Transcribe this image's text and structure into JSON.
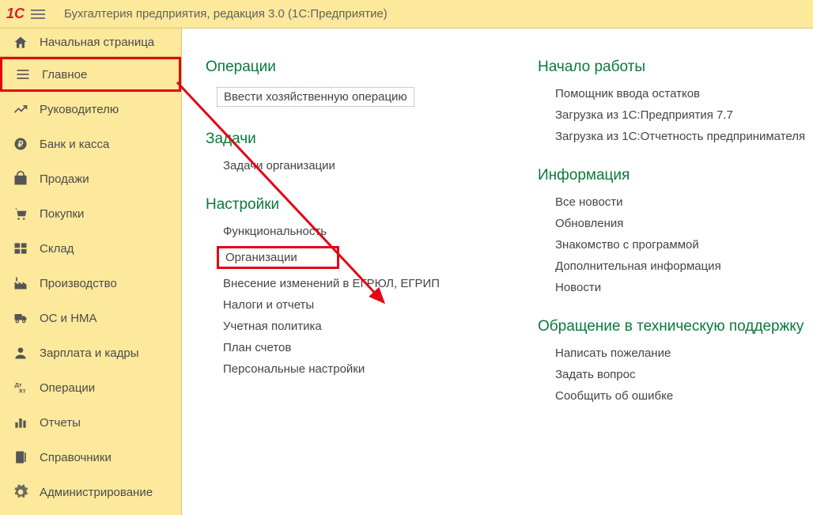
{
  "topbar": {
    "title": "Бухгалтерия предприятия, редакция 3.0   (1С:Предприятие)"
  },
  "sidebar": {
    "start_page": "Начальная страница",
    "items": [
      {
        "icon": "main-icon",
        "label": "Главное",
        "highlighted": true
      },
      {
        "icon": "chart-icon",
        "label": "Руководителю"
      },
      {
        "icon": "ruble-icon",
        "label": "Банк и касса"
      },
      {
        "icon": "bag-icon",
        "label": "Продажи"
      },
      {
        "icon": "cart-icon",
        "label": "Покупки"
      },
      {
        "icon": "boxes-icon",
        "label": "Склад"
      },
      {
        "icon": "factory-icon",
        "label": "Производство"
      },
      {
        "icon": "truck-icon",
        "label": "ОС и НМА"
      },
      {
        "icon": "person-icon",
        "label": "Зарплата и кадры"
      },
      {
        "icon": "operations-icon",
        "label": "Операции"
      },
      {
        "icon": "reports-icon",
        "label": "Отчеты"
      },
      {
        "icon": "reference-icon",
        "label": "Справочники"
      },
      {
        "icon": "gear-icon",
        "label": "Администрирование"
      }
    ]
  },
  "content": {
    "left": [
      {
        "title": "Операции",
        "links": [
          {
            "label": "Ввести хозяйственную операцию",
            "dotted": true
          }
        ]
      },
      {
        "title": "Задачи",
        "links": [
          {
            "label": "Задачи организации"
          }
        ]
      },
      {
        "title": "Настройки",
        "links": [
          {
            "label": "Функциональность"
          },
          {
            "label": "Организации",
            "highlighted": true
          },
          {
            "label": "Внесение изменений в ЕГРЮЛ, ЕГРИП"
          },
          {
            "label": "Налоги и отчеты"
          },
          {
            "label": "Учетная политика"
          },
          {
            "label": "План счетов"
          },
          {
            "label": "Персональные настройки"
          }
        ]
      }
    ],
    "right": [
      {
        "title": "Начало работы",
        "links": [
          {
            "label": "Помощник ввода остатков"
          },
          {
            "label": "Загрузка из 1С:Предприятия 7.7"
          },
          {
            "label": "Загрузка из 1С:Отчетность предпринимателя"
          }
        ]
      },
      {
        "title": "Информация",
        "links": [
          {
            "label": "Все новости"
          },
          {
            "label": "Обновления"
          },
          {
            "label": "Знакомство с программой"
          },
          {
            "label": "Дополнительная информация"
          },
          {
            "label": "Новости"
          }
        ]
      },
      {
        "title": "Обращение в техническую поддержку",
        "links": [
          {
            "label": "Написать пожелание"
          },
          {
            "label": "Задать вопрос"
          },
          {
            "label": "Сообщить об ошибке"
          }
        ]
      }
    ]
  }
}
